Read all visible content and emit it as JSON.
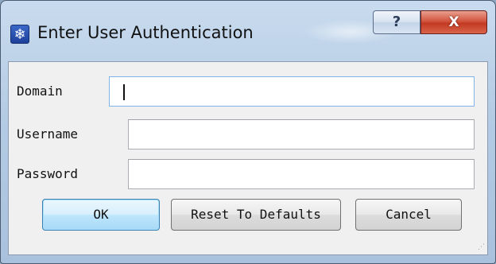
{
  "window": {
    "title": "Enter User Authentication",
    "app_icon": "snowflake-icon",
    "help_glyph": "?",
    "close_glyph": "X"
  },
  "form": {
    "domain_label": "Domain",
    "domain_value": "",
    "username_label": "Username",
    "username_value": "",
    "password_label": "Password",
    "password_value": ""
  },
  "buttons": {
    "ok_label": "OK",
    "reset_label": "Reset To Defaults",
    "cancel_label": "Cancel"
  },
  "colors": {
    "close_button": "#c23a22",
    "default_button_border": "#3c7fb1",
    "focused_input_border": "#7eb4ea",
    "dialog_background": "#f0f0f0"
  }
}
